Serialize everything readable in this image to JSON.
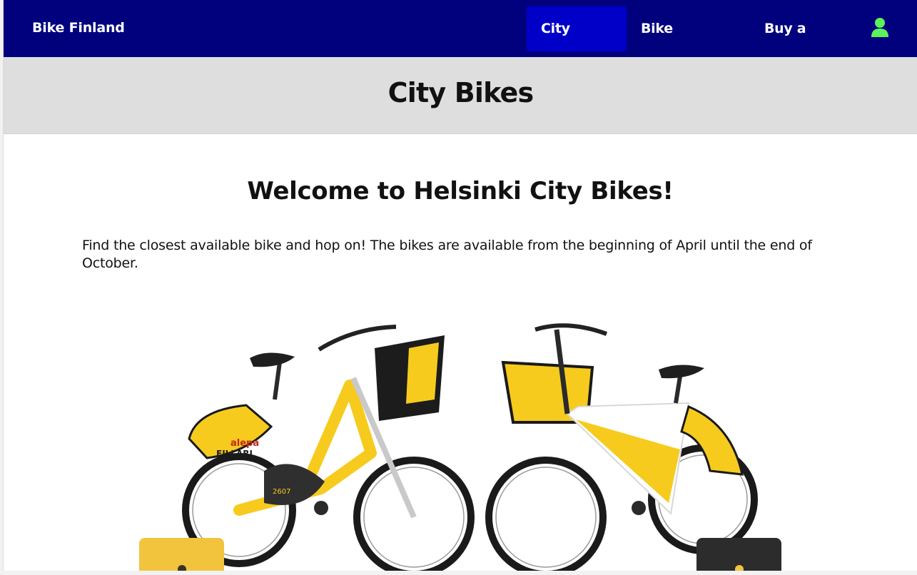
{
  "nav": {
    "brand": "Bike Finland",
    "items": [
      {
        "label": "City Bikes",
        "active": true
      },
      {
        "label": "Bike Stations",
        "active": false
      },
      {
        "label": "Buy a Pass",
        "active": false
      }
    ],
    "user_icon": "user-icon",
    "bg_color": "#01017e",
    "active_color": "#0000c9",
    "user_icon_color": "#5cf25c"
  },
  "header": {
    "title": "City Bikes"
  },
  "main": {
    "welcome": "Welcome to Helsinki City Bikes!",
    "intro": "Find the closest available bike and hop on! The bikes are available from the beginning of April until the end of October.",
    "image": {
      "logo_brand": "alepa",
      "logo_name": "FILLARI",
      "bike_number": "2607",
      "bike_colors": [
        "#f6cb1e",
        "#ffffff"
      ]
    }
  },
  "colors": {
    "title_band": "#dedede",
    "tab_yellow": "#f2c43e",
    "tab_dark": "#2c2c2c"
  }
}
